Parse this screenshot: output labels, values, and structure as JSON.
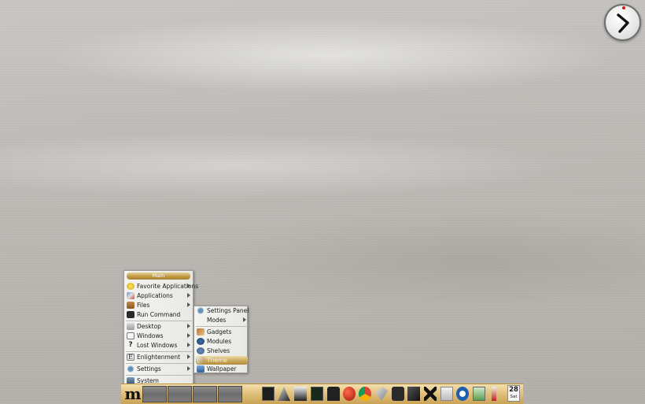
{
  "main_menu": {
    "title": "Main",
    "items": [
      {
        "label": "Favorite Applications",
        "icon": "star-icon",
        "submenu": true
      },
      {
        "label": "Applications",
        "icon": "apps-icon",
        "submenu": true
      },
      {
        "label": "Files",
        "icon": "folder-icon",
        "submenu": true
      },
      {
        "label": "Run Command",
        "icon": "run-icon",
        "submenu": false
      },
      {
        "label": "Desktop",
        "icon": "desktop-icon",
        "submenu": true
      },
      {
        "label": "Windows",
        "icon": "windows-icon",
        "submenu": true
      },
      {
        "label": "Lost Windows",
        "icon": "question-icon",
        "submenu": true
      },
      {
        "label": "Enlightenment",
        "icon": "enlightenment-icon",
        "submenu": true
      },
      {
        "label": "Settings",
        "icon": "settings-icon",
        "submenu": true
      },
      {
        "label": "System",
        "icon": "system-icon",
        "submenu": false
      }
    ]
  },
  "settings_submenu": {
    "items": [
      {
        "label": "Settings Panel",
        "icon": "settings-icon",
        "submenu": false
      },
      {
        "label": "Modes",
        "icon": "",
        "submenu": true
      },
      {
        "label": "Gadgets",
        "icon": "gadgets-icon",
        "submenu": false
      },
      {
        "label": "Modules",
        "icon": "modules-icon",
        "submenu": false
      },
      {
        "label": "Shelves",
        "icon": "shelves-icon",
        "submenu": false
      },
      {
        "label": "Theme",
        "icon": "theme-icon",
        "submenu": false,
        "active": true
      },
      {
        "label": "Wallpaper",
        "icon": "wallpaper-icon",
        "submenu": false
      }
    ]
  },
  "shelf": {
    "start_glyph": "m",
    "tray_icons": [
      "terminal-icon",
      "ink-icon",
      "document-icon",
      "monitor-icon",
      "hat-icon",
      "red-ball-icon",
      "chrome-icon",
      "bird-icon",
      "camera-icon",
      "compass-icon",
      "x-tools-icon",
      "writer-icon",
      "power-icon",
      "battery-icon",
      "thermometer-icon"
    ],
    "date_day": "28",
    "date_weekday": "Sat"
  },
  "colors": {
    "accent_gold": "#c9a255",
    "menu_bg": "#f0f0ee"
  }
}
